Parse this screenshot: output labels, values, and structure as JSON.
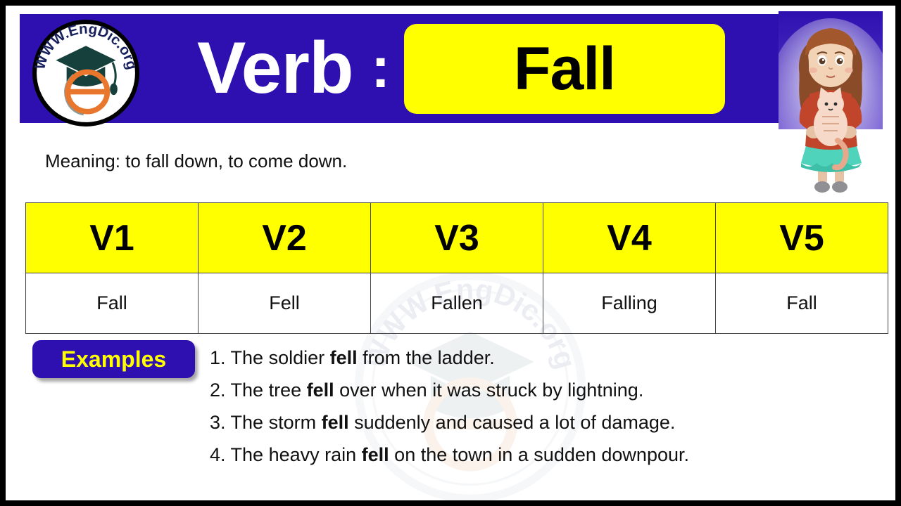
{
  "colors": {
    "brand_blue": "#2e10b0",
    "accent_yellow": "#ffff00",
    "text_black": "#111111",
    "border_black": "#000000"
  },
  "header": {
    "logo_alt": "engdic-logo",
    "logo_text": "WWW.EngDic.org",
    "verb_label": "Verb",
    "colon": ":",
    "verb_name": "Fall",
    "illustration_alt": "girl-holding-cat-illustration"
  },
  "meaning": {
    "text": "Meaning: to fall down, to come down."
  },
  "table": {
    "headers": [
      "V1",
      "V2",
      "V3",
      "V4",
      "V5"
    ],
    "row": [
      "Fall",
      "Fell",
      "Fallen",
      "Falling",
      "Fall"
    ]
  },
  "examples": {
    "badge_label": "Examples",
    "items": [
      {
        "number": "1.",
        "before": " The soldier ",
        "bold": "fell",
        "after": " from the ladder."
      },
      {
        "number": "2.",
        "before": " The tree ",
        "bold": "fell",
        "after": " over when it was struck by lightning."
      },
      {
        "number": "3.",
        "before": " The storm ",
        "bold": "fell",
        "after": " suddenly and caused a lot of damage."
      },
      {
        "number": "4.",
        "before": " The heavy rain ",
        "bold": "fell",
        "after": " on the town in a sudden downpour."
      }
    ]
  },
  "watermark": {
    "text": "WWW.EngDic.org"
  }
}
